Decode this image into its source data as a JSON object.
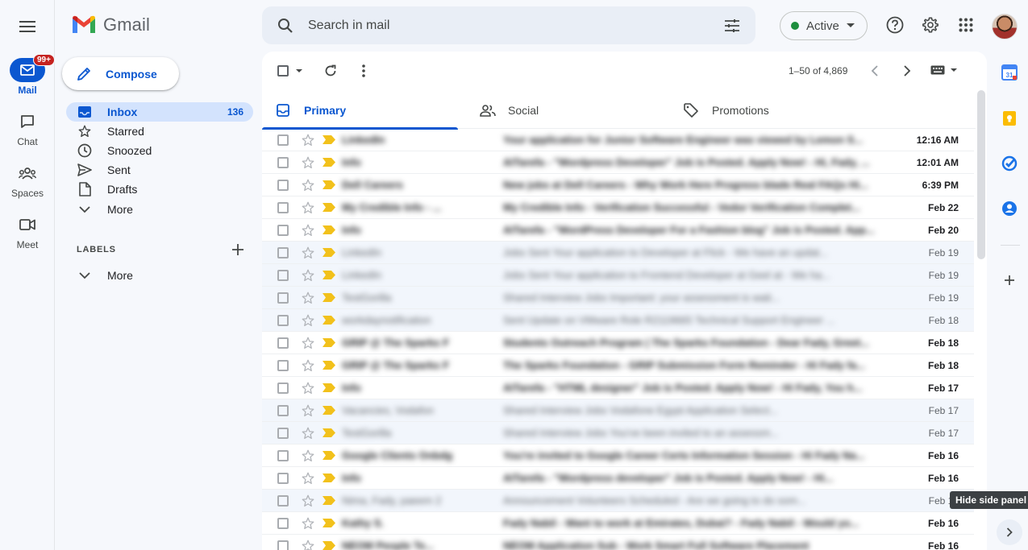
{
  "app": {
    "logo_text": "Gmail"
  },
  "rail": [
    {
      "label": "Mail",
      "badge": "99+"
    },
    {
      "label": "Chat"
    },
    {
      "label": "Spaces"
    },
    {
      "label": "Meet"
    }
  ],
  "compose_label": "Compose",
  "nav": {
    "inbox": {
      "label": "Inbox",
      "count": "136"
    },
    "starred": "Starred",
    "snoozed": "Snoozed",
    "sent": "Sent",
    "drafts": "Drafts",
    "more": "More"
  },
  "labels": {
    "heading": "LABELS",
    "more": "More"
  },
  "search": {
    "placeholder": "Search in mail"
  },
  "status": {
    "label": "Active",
    "color": "#1e8e3e"
  },
  "pager": "1–50 of 4,869",
  "tabs": {
    "primary": "Primary",
    "social": "Social",
    "promotions": "Promotions"
  },
  "emails": [
    {
      "sender": "LinkedIn",
      "subject": "Your application for Junior Software Engineer was viewed by Lemon S...",
      "date": "12:16 AM",
      "unread": true
    },
    {
      "sender": "Info",
      "subject": "AITarefa - \"Wordpress Developer\" Job is Posted. Apply Now! - Hi, Fady, ...",
      "date": "12:01 AM",
      "unread": true
    },
    {
      "sender": "Dell Careers",
      "subject": "New jobs at Dell Careers - Why Work Here Progress blade Real FAQs Hi...",
      "date": "6:39 PM",
      "unread": true
    },
    {
      "sender": "My Credible Info - ...",
      "subject": "My Credible Info - Verification Successful - Vedor Verification Complet...",
      "date": "Feb 22",
      "unread": true
    },
    {
      "sender": "Info",
      "subject": "AITarefa - \"WordPress Developer For a Fashion blog\" Job is Posted. App...",
      "date": "Feb 20",
      "unread": true
    },
    {
      "sender": "LinkedIn",
      "subject": "Jobs Sent Your application to Developer at Flick - We have an updat...",
      "date": "Feb 19",
      "unread": false
    },
    {
      "sender": "LinkedIn",
      "subject": "Jobs Sent Your application to Frontend Developer at Geel at - We ha...",
      "date": "Feb 19",
      "unread": false
    },
    {
      "sender": "TestGorilla",
      "subject": "Shared Interview Jobs Important: your assessment is wait...",
      "date": "Feb 19",
      "unread": false
    },
    {
      "sender": "workdaynotification",
      "subject": "Sent Update on VMware Role R2119665 Technical Support Engineer ...",
      "date": "Feb 18",
      "unread": false
    },
    {
      "sender": "GRIP @ The Sparks F",
      "subject": "Students Outreach Program | The Sparks Foundation - Dear Fady, Greet...",
      "date": "Feb 18",
      "unread": true
    },
    {
      "sender": "GRIP @ The Sparks F",
      "subject": "The Sparks Foundation - GRIP Submission Form Reminder - Hi Fady fa...",
      "date": "Feb 18",
      "unread": true
    },
    {
      "sender": "Info",
      "subject": "AITarefa - \"HTML designer\" Job is Posted. Apply Now! - Hi Fady, You h...",
      "date": "Feb 17",
      "unread": true
    },
    {
      "sender": "Vacancies, Vodafon",
      "subject": "Shared Interview Jobs Vodafone Egypt Application Select...",
      "date": "Feb 17",
      "unread": false
    },
    {
      "sender": "TestGorilla",
      "subject": "Shared Interview Jobs You've been invited to an assessm...",
      "date": "Feb 17",
      "unread": false
    },
    {
      "sender": "Google Clients Onbdg",
      "subject": "You're invited to Google Career Certs Information Session - Hi Fady Na...",
      "date": "Feb 16",
      "unread": true
    },
    {
      "sender": "Info",
      "subject": "AITarefa - \"Wordpress developer\" Job is Posted. Apply Now! - Hi...",
      "date": "Feb 16",
      "unread": true
    },
    {
      "sender": "Nima, Fady, paeem 2",
      "subject": "Announcement Volunteers Scheduled - Are we going to do som...",
      "date": "Feb 16",
      "unread": false
    },
    {
      "sender": "Kathy S.",
      "subject": "Fady Nabil - Want to work at Emirates, Dubai? - Fady Nabil - Would yo...",
      "date": "Feb 16",
      "unread": true
    },
    {
      "sender": "NEOM People Te...",
      "subject": "NEOM Application Sub - Work Smart Full Software Placement",
      "date": "Feb 16",
      "unread": true
    }
  ],
  "tooltip": "Hide side panel"
}
